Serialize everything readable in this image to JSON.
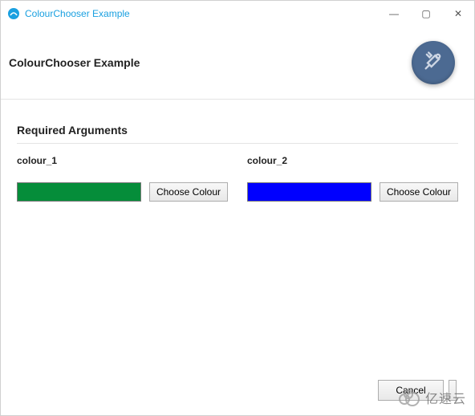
{
  "window": {
    "title": "ColourChooser Example"
  },
  "header": {
    "title": "ColourChooser Example"
  },
  "section": {
    "title": "Required Arguments"
  },
  "fields": {
    "colour_1": {
      "label": "colour_1",
      "button": "Choose Colour",
      "swatch": "#058d3a"
    },
    "colour_2": {
      "label": "colour_2",
      "button": "Choose Colour",
      "swatch": "#0000ff"
    }
  },
  "footer": {
    "cancel": "Cancel"
  },
  "watermark": {
    "text": "亿速云"
  },
  "icons": {
    "min": "—",
    "max": "▢",
    "close": "✕"
  }
}
